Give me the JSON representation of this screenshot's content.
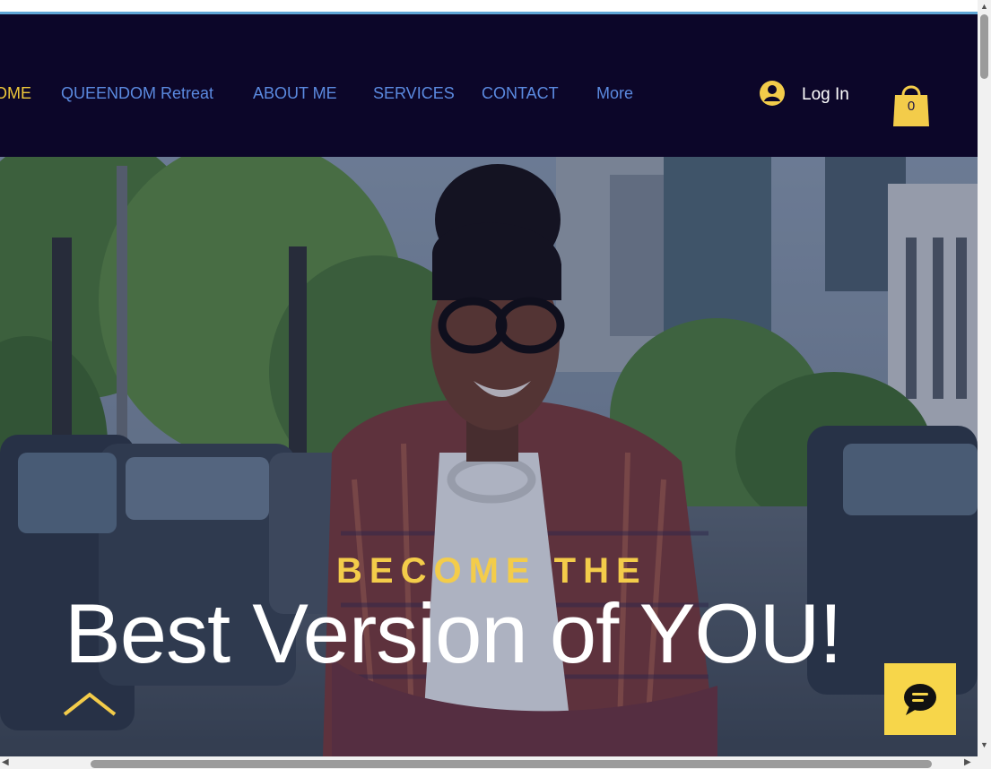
{
  "nav": {
    "items": [
      {
        "label": "OME",
        "active": true
      },
      {
        "label": "QUEENDOM Retreat",
        "active": false
      },
      {
        "label": "ABOUT ME",
        "active": false
      },
      {
        "label": "SERVICES",
        "active": false
      },
      {
        "label": "CONTACT",
        "active": false
      },
      {
        "label": "More",
        "active": false
      }
    ]
  },
  "login": {
    "label": "Log In",
    "icon": "user-avatar-icon"
  },
  "cart": {
    "count": "0",
    "icon": "shopping-bag-icon"
  },
  "hero": {
    "eyebrow": "BECOME THE",
    "headline": "Best Version of YOU!",
    "image_alt": "woman in tweed blazer and glasses standing on city street"
  },
  "colors": {
    "header_bg": "#0c0629",
    "nav_link": "#5b8ae0",
    "nav_active": "#f0c93a",
    "accent_yellow": "#f3cc4a",
    "chat_button": "#f7d64a"
  },
  "chat": {
    "icon": "chat-bubble-icon"
  },
  "scroll_up": {
    "icon": "chevron-up-icon"
  }
}
